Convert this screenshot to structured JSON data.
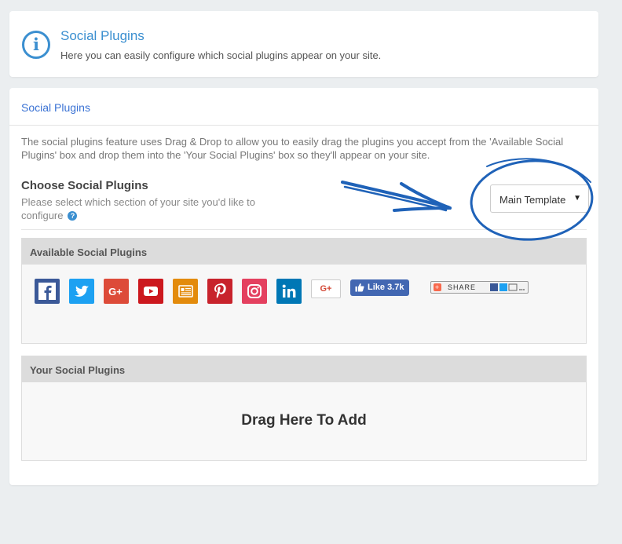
{
  "header": {
    "title": "Social Plugins",
    "subtitle": "Here you can easily configure which social plugins appear on your site.",
    "icon": "info-icon"
  },
  "main": {
    "title": "Social Plugins",
    "description": "The social plugins feature uses Drag & Drop to allow you to easily drag the plugins you accept from the 'Available Social Plugins' box and drop them into the 'Your Social Plugins' box so they'll appear on your site.",
    "choose": {
      "title": "Choose Social Plugins",
      "help": "Please select which section of your site you'd like to configure",
      "help_icon": "question-icon"
    },
    "select": {
      "value": "Main Template"
    }
  },
  "available": {
    "title": "Available Social Plugins",
    "plugins": [
      {
        "name": "facebook",
        "color": "#3b5998"
      },
      {
        "name": "twitter",
        "color": "#1da1f2"
      },
      {
        "name": "google-plus",
        "color": "#dd4b39"
      },
      {
        "name": "youtube",
        "color": "#cc181e"
      },
      {
        "name": "rss-feed",
        "color": "#e38b0c"
      },
      {
        "name": "pinterest",
        "color": "#c8232c"
      },
      {
        "name": "instagram",
        "color": "#e4405f"
      },
      {
        "name": "linkedin",
        "color": "#0077b5"
      }
    ],
    "gplus_label": "G+",
    "like_label": "Like 3.7k",
    "share_label": "SHARE"
  },
  "yours": {
    "title": "Your Social Plugins",
    "drop_label": "Drag Here To Add"
  },
  "colors": {
    "accent": "#3b8fd0",
    "annotation": "#1f62b8"
  }
}
